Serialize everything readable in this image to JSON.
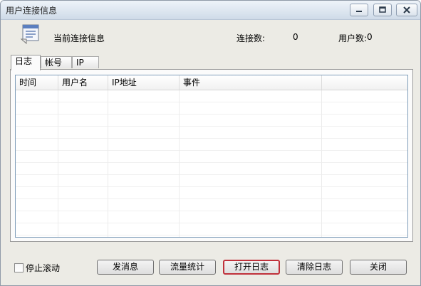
{
  "window": {
    "title": "用户连接信息",
    "controls": {
      "minimize_icon": "minimize-icon",
      "maximize_icon": "maximize-icon",
      "close_icon": "close-icon"
    }
  },
  "header": {
    "icon": "user-list-icon",
    "title": "当前连接信息",
    "connections_label": "连接数:",
    "connections_value": "0",
    "users_label": "用户数:",
    "users_value": "0"
  },
  "tabs": [
    {
      "label": "日志",
      "active": true
    },
    {
      "label": "帐号",
      "active": false
    },
    {
      "label": "IP",
      "active": false
    }
  ],
  "log_table": {
    "columns": [
      "时间",
      "用户名",
      "IP地址",
      "事件",
      ""
    ],
    "rows": []
  },
  "footer": {
    "stop_scroll_label": "停止滚动",
    "stop_scroll_checked": false,
    "buttons": {
      "send_message": "发消息",
      "traffic_stats": "流量统计",
      "open_log": "打开日志",
      "clear_log": "清除日志",
      "close": "关闭"
    }
  },
  "colors": {
    "window_bg": "#ecebe5",
    "focus_border": "#c0313b",
    "listview_border": "#7f9db9"
  }
}
